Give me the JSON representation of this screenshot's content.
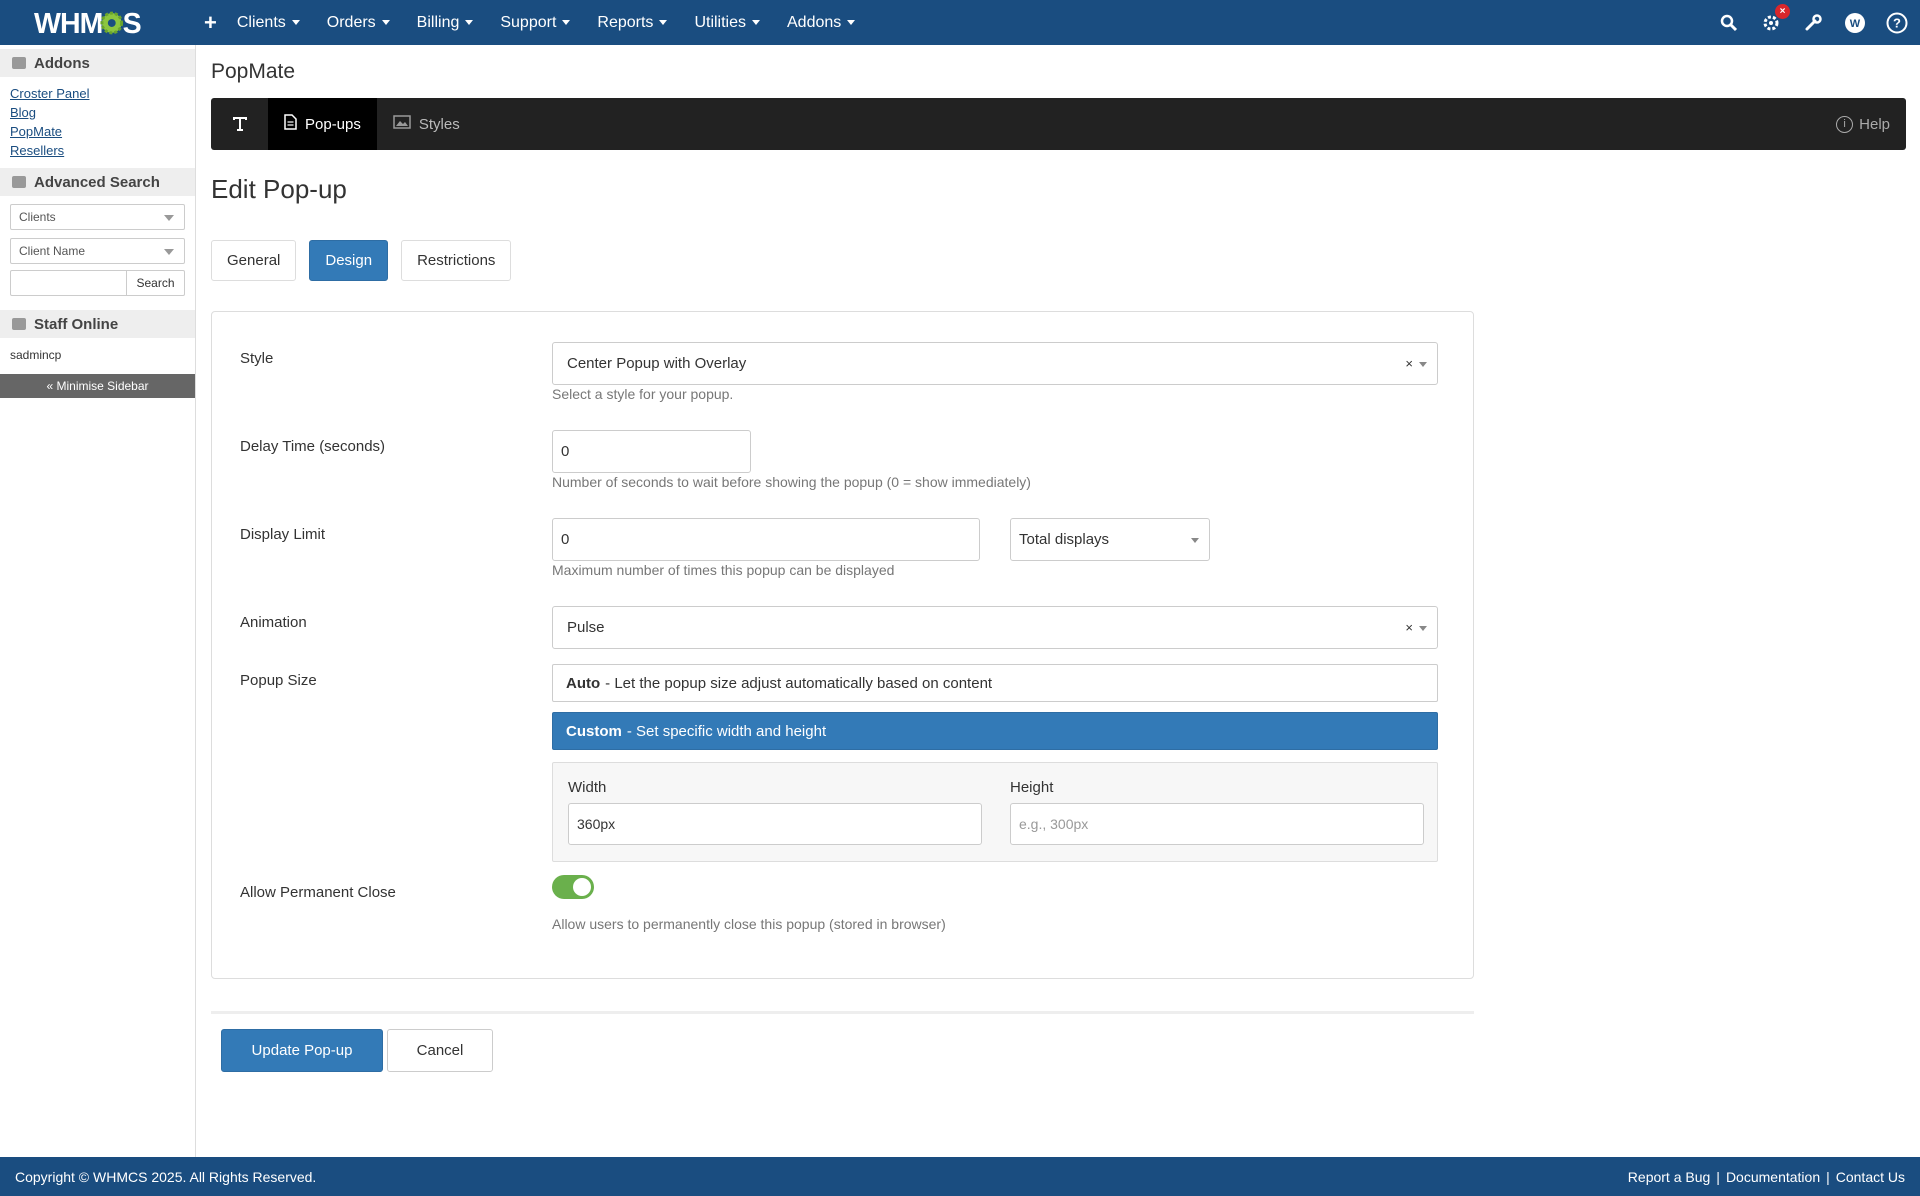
{
  "topnav": {
    "logo": "WHMCS",
    "plus": "+",
    "items": [
      "Clients",
      "Orders",
      "Billing",
      "Support",
      "Reports",
      "Utilities",
      "Addons"
    ],
    "badge": "×"
  },
  "sidebar": {
    "addons_title": "Addons",
    "addons_links": [
      "Croster Panel",
      "Blog",
      "PopMate",
      "Resellers"
    ],
    "advsearch_title": "Advanced Search",
    "select1": "Clients",
    "select2": "Client Name",
    "search_button": "Search",
    "staff_title": "Staff Online",
    "staff_user": "sadmincp",
    "minimise": "« Minimise Sidebar"
  },
  "module": {
    "title": "PopMate",
    "tabs": [
      "Pop-ups",
      "Styles"
    ],
    "help": "Help"
  },
  "form": {
    "title": "Edit Pop-up",
    "subtabs": [
      "General",
      "Design",
      "Restrictions"
    ],
    "style": {
      "label": "Style",
      "value": "Center Popup with Overlay",
      "help": "Select a style for your popup."
    },
    "delay": {
      "label": "Delay Time (seconds)",
      "value": "0",
      "help": "Number of seconds to wait before showing the popup (0 = show immediately)"
    },
    "limit": {
      "label": "Display Limit",
      "value": "0",
      "mode": "Total displays",
      "help": "Maximum number of times this popup can be displayed"
    },
    "animation": {
      "label": "Animation",
      "value": "Pulse"
    },
    "size": {
      "label": "Popup Size",
      "auto_title": "Auto",
      "auto_desc": "- Let the popup size adjust automatically based on content",
      "custom_title": "Custom",
      "custom_desc": "- Set specific width and height",
      "width_label": "Width",
      "width_value": "360px",
      "height_label": "Height",
      "height_placeholder": "e.g., 300px"
    },
    "perm_close": {
      "label": "Allow Permanent Close",
      "enabled": true,
      "help": "Allow users to permanently close this popup (stored in browser)"
    },
    "clear_x": "×",
    "update_button": "Update Pop-up",
    "cancel_button": "Cancel"
  },
  "footer": {
    "copyright": "Copyright © WHMCS 2025. All Rights Reserved.",
    "links": [
      "Report a Bug",
      "Documentation",
      "Contact Us"
    ],
    "sep": "|"
  }
}
